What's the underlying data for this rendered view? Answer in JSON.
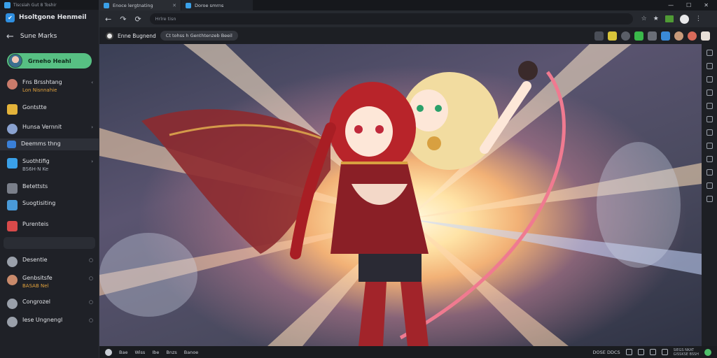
{
  "sidebar": {
    "app_label": "Tiscsiah Gut 8 Toshir",
    "title": "Hsoltgone Henmeil",
    "back_label": "Sune Marks",
    "profile_pill": "Grneho Heahl",
    "items": [
      {
        "label": "Fns Brsshtang",
        "sub": "Lon Nisnnahie",
        "color": "#c97b6b",
        "chev": "‹"
      },
      {
        "label": "Gontstte",
        "sub": "",
        "color": "#e4b33a",
        "chev": ""
      },
      {
        "label": "Hunsa Vernnit",
        "sub": "",
        "color": "#8aa2d0",
        "chev": "›"
      },
      {
        "label": "Deemms thng",
        "sub": "",
        "color": "#3a80d8",
        "chev": ""
      },
      {
        "label": "Suothtifig",
        "sub": "BS6H·N Ke",
        "color": "#3aa0e8",
        "chev": "›"
      },
      {
        "label": "Betettsts",
        "sub": "",
        "color": "#7a7f8a",
        "chev": ""
      },
      {
        "label": "Suogtisiting",
        "sub": "",
        "color": "#4a9ad8",
        "chev": ""
      },
      {
        "label": "Purenteis",
        "sub": "",
        "color": "#d84a4a",
        "chev": ""
      },
      {
        "label": "Desentie",
        "sub": "",
        "color": "#9aa0aa",
        "chev": "○"
      },
      {
        "label": "Genbsitsfe",
        "sub": "BASAB Nel",
        "color": "#c98a6b",
        "chev": "○"
      },
      {
        "label": "Congrozel",
        "sub": "",
        "color": "#9aa0aa",
        "chev": "○"
      },
      {
        "label": "Iese Ungnengl",
        "sub": "",
        "color": "#9aa0aa",
        "chev": "○"
      }
    ]
  },
  "browser": {
    "tabs": [
      {
        "label": "Enoce lergtnating",
        "active": true
      },
      {
        "label": "Doroe smrns",
        "active": false
      }
    ],
    "url_placeholder": "Hrlre tisn",
    "channel": "Enne Bugnend",
    "chip": "Ct tohss h Genthtenzeb Beeil",
    "icons": {
      "back": "←",
      "forward": "↷",
      "reload": "⟳",
      "star": "☆",
      "star2": "★",
      "more": "⋮"
    }
  },
  "bottombar": {
    "items": [
      "Bae",
      "Wiss",
      "Ibe",
      "Bnzs",
      "Banoe"
    ],
    "right_text": "DOSE DDCS",
    "stack_text": "SIEGS NKAT\nGISSKSE BSSH"
  }
}
